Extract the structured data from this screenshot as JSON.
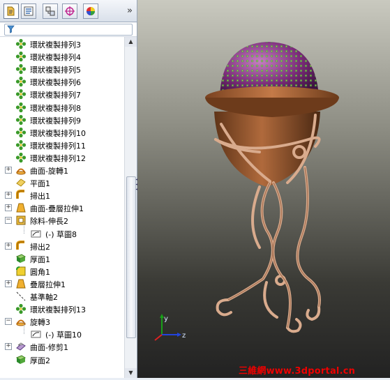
{
  "tabs": [
    {
      "name": "feature-manager-tab-icon",
      "active": true
    },
    {
      "name": "property-manager-tab-icon",
      "active": false
    },
    {
      "name": "configuration-manager-tab-icon",
      "active": false
    },
    {
      "name": "dimxpert-tab-icon",
      "active": false
    },
    {
      "name": "display-manager-tab-icon",
      "active": false
    }
  ],
  "more_label": "»",
  "tree": {
    "items": [
      {
        "label": "環狀複製排列3",
        "icon": "circular-pattern-icon",
        "depth": 1,
        "expander": ""
      },
      {
        "label": "環狀複製排列4",
        "icon": "circular-pattern-icon",
        "depth": 1,
        "expander": ""
      },
      {
        "label": "環狀複製排列5",
        "icon": "circular-pattern-icon",
        "depth": 1,
        "expander": ""
      },
      {
        "label": "環狀複製排列6",
        "icon": "circular-pattern-icon",
        "depth": 1,
        "expander": ""
      },
      {
        "label": "環狀複製排列7",
        "icon": "circular-pattern-icon",
        "depth": 1,
        "expander": ""
      },
      {
        "label": "環狀複製排列8",
        "icon": "circular-pattern-icon",
        "depth": 1,
        "expander": ""
      },
      {
        "label": "環狀複製排列9",
        "icon": "circular-pattern-icon",
        "depth": 1,
        "expander": ""
      },
      {
        "label": "環狀複製排列10",
        "icon": "circular-pattern-icon",
        "depth": 1,
        "expander": ""
      },
      {
        "label": "環狀複製排列11",
        "icon": "circular-pattern-icon",
        "depth": 1,
        "expander": ""
      },
      {
        "label": "環狀複製排列12",
        "icon": "circular-pattern-icon",
        "depth": 1,
        "expander": ""
      },
      {
        "label": "曲面-旋轉1",
        "icon": "surface-revolve-icon",
        "depth": 1,
        "expander": "+"
      },
      {
        "label": "平面1",
        "icon": "plane-icon",
        "depth": 1,
        "expander": ""
      },
      {
        "label": "掃出1",
        "icon": "sweep-icon",
        "depth": 1,
        "expander": "+"
      },
      {
        "label": "曲面-疊層拉伸1",
        "icon": "surface-loft-icon",
        "depth": 1,
        "expander": "+"
      },
      {
        "label": "除料-伸長2",
        "icon": "cut-extrude-icon",
        "depth": 1,
        "expander": "−"
      },
      {
        "label": "(-) 草圖8",
        "icon": "sketch-icon",
        "depth": 2,
        "expander": ""
      },
      {
        "label": "掃出2",
        "icon": "sweep-icon",
        "depth": 1,
        "expander": "+"
      },
      {
        "label": "厚面1",
        "icon": "thicken-icon",
        "depth": 1,
        "expander": ""
      },
      {
        "label": "圓角1",
        "icon": "fillet-icon",
        "depth": 1,
        "expander": ""
      },
      {
        "label": "疊層拉伸1",
        "icon": "loft-icon",
        "depth": 1,
        "expander": "+"
      },
      {
        "label": "基準軸2",
        "icon": "axis-icon",
        "depth": 1,
        "expander": ""
      },
      {
        "label": "環狀複製排列13",
        "icon": "circular-pattern-icon",
        "depth": 1,
        "expander": ""
      },
      {
        "label": "旋轉3",
        "icon": "revolve-icon",
        "depth": 1,
        "expander": "−"
      },
      {
        "label": "(-) 草圖10",
        "icon": "sketch-icon",
        "depth": 2,
        "expander": ""
      },
      {
        "label": "曲面-修剪1",
        "icon": "surface-trim-icon",
        "depth": 1,
        "expander": "+"
      },
      {
        "label": "厚面2",
        "icon": "thicken-icon",
        "depth": 1,
        "expander": ""
      }
    ]
  },
  "triad": {
    "y_label": "y",
    "z_label": "z"
  },
  "watermark": "三維網www.3dportal.cn",
  "colors": {
    "pot": "#9a5a35",
    "flower": "#8a2c86",
    "stand": "#d8aa8c",
    "viewport_top": "#c9c9bf",
    "viewport_bottom": "#222222",
    "watermark": "#ee0000"
  }
}
